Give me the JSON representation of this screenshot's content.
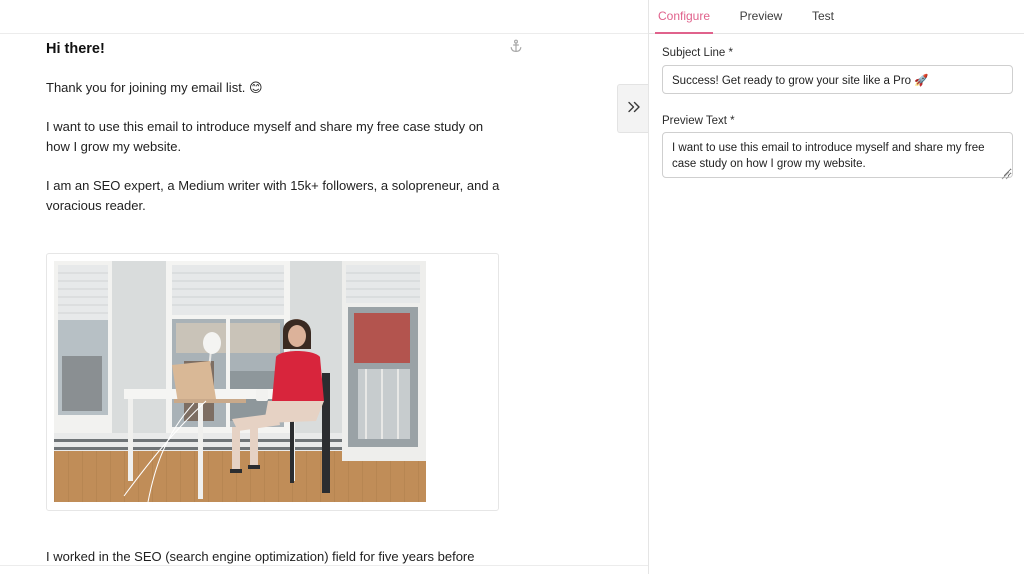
{
  "editor": {
    "greeting": "Hi there!",
    "paragraph_1": "Thank you for joining my email list. 😊",
    "paragraph_2": "I want to use this email to introduce myself and share my free case study on how I grow my website.",
    "paragraph_3": "I am an SEO expert, a Medium writer with 15k+ followers, a solopreneur, and a voracious reader.",
    "paragraph_4": "I worked in the SEO (search engine optimization) field for five years before",
    "icons": {
      "anchor": "anchor-icon",
      "collapse": "double-chevron-right-icon"
    }
  },
  "panel": {
    "tabs": [
      {
        "label": "Configure",
        "active": true
      },
      {
        "label": "Preview",
        "active": false
      },
      {
        "label": "Test",
        "active": false
      }
    ],
    "subject": {
      "label": "Subject Line *",
      "value": "Success! Get ready to grow your site like a Pro 🚀"
    },
    "preview_text": {
      "label": "Preview Text *",
      "value": "I want to use this email to introduce myself and share my free case study on how I grow my website."
    }
  },
  "colors": {
    "accent": "#e0628c",
    "border": "#e5e5e5",
    "text": "#1f1f1f",
    "toggle_bg": "#f3f3f3"
  }
}
